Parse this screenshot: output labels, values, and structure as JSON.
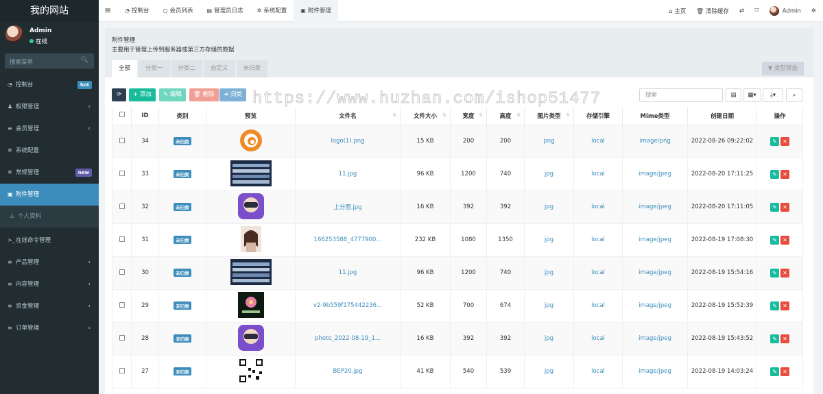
{
  "site_title": "我的网站",
  "user": {
    "name": "Admin",
    "status": "在线"
  },
  "search": {
    "placeholder": "搜索菜单"
  },
  "menu": [
    {
      "label": "控制台",
      "icon": "dashboard-icon",
      "badge": "hot",
      "badge_color": "#3c8dbc"
    },
    {
      "label": "权限管理",
      "icon": "users-icon",
      "arrow": true
    },
    {
      "label": "会员管理",
      "icon": "list-icon",
      "arrow": true
    },
    {
      "label": "系统配置",
      "icon": "cog-icon"
    },
    {
      "label": "常规管理",
      "icon": "cogs-icon",
      "badge": "new",
      "badge_color": "#605ca8"
    },
    {
      "label": "附件管理",
      "icon": "file-image-icon",
      "active": true
    },
    {
      "label": "个人资料",
      "icon": "user-icon",
      "sub": true
    },
    {
      "label": "在线命令管理",
      "icon": "terminal-icon"
    },
    {
      "label": "产品管理",
      "icon": "list-icon",
      "arrow": true
    },
    {
      "label": "内容管理",
      "icon": "list-icon",
      "arrow": true
    },
    {
      "label": "资金管理",
      "icon": "list-icon",
      "arrow": true
    },
    {
      "label": "订单管理",
      "icon": "list-icon",
      "arrow": true
    }
  ],
  "top_tabs": [
    {
      "label": "控制台",
      "icon": "dashboard-icon"
    },
    {
      "label": "会员列表",
      "icon": "circle-icon"
    },
    {
      "label": "管理员日志",
      "icon": "list-icon"
    },
    {
      "label": "系统配置",
      "icon": "cog-icon"
    },
    {
      "label": "附件管理",
      "icon": "file-image-icon",
      "active": true
    }
  ],
  "top_right": {
    "home": "主页",
    "clear_cache": "清除缓存",
    "admin": "Admin"
  },
  "panel": {
    "title": "附件管理",
    "description": "主要用于管理上传到服务器或第三方存储的数据",
    "category_tabs": [
      "全部",
      "分类一",
      "分类二",
      "自定义",
      "未归类"
    ],
    "filter_label": "类型筛选"
  },
  "toolbar": {
    "add": "添加",
    "edit": "编辑",
    "delete": "删除",
    "classify": "归类",
    "search_placeholder": "搜索"
  },
  "watermark": "https://www.huzhan.com/ishop51477",
  "table": {
    "headers": [
      "ID",
      "类别",
      "预览",
      "文件名",
      "文件大小",
      "宽度",
      "高度",
      "图片类型",
      "存储引擎",
      "Mime类型",
      "创建日期",
      "操作"
    ],
    "rows": [
      {
        "id": "34",
        "category": "未归类",
        "preview": "logo",
        "filename": "logo(1).png",
        "size": "15 KB",
        "width": "200",
        "height": "200",
        "type": "png",
        "storage": "local",
        "mime": "image/png",
        "date": "2022-08-26 09:22:02"
      },
      {
        "id": "33",
        "category": "未归类",
        "preview": "servers",
        "filename": "11.jpg",
        "size": "96 KB",
        "width": "1200",
        "height": "740",
        "type": "jpg",
        "storage": "local",
        "mime": "image/jpeg",
        "date": "2022-08-20 17:11:25"
      },
      {
        "id": "32",
        "category": "未归类",
        "preview": "vr",
        "filename": "上分图.jpg",
        "size": "16 KB",
        "width": "392",
        "height": "392",
        "type": "jpg",
        "storage": "local",
        "mime": "image/jpeg",
        "date": "2022-08-20 17:11:05"
      },
      {
        "id": "31",
        "category": "未归类",
        "preview": "person",
        "filename": "166253588_4777900...",
        "size": "232 KB",
        "width": "1080",
        "height": "1350",
        "type": "jpg",
        "storage": "local",
        "mime": "image/jpeg",
        "date": "2022-08-19 17:08:30"
      },
      {
        "id": "30",
        "category": "未归类",
        "preview": "servers",
        "filename": "11.jpg",
        "size": "96 KB",
        "width": "1200",
        "height": "740",
        "type": "jpg",
        "storage": "local",
        "mime": "image/jpeg",
        "date": "2022-08-19 15:54:16"
      },
      {
        "id": "29",
        "category": "未归类",
        "preview": "flower",
        "filename": "v2-9b559f175442236...",
        "size": "52 KB",
        "width": "700",
        "height": "674",
        "type": "jpg",
        "storage": "local",
        "mime": "image/jpeg",
        "date": "2022-08-19 15:52:39"
      },
      {
        "id": "28",
        "category": "未归类",
        "preview": "vr",
        "filename": "photo_2022-08-19_1...",
        "size": "16 KB",
        "width": "392",
        "height": "392",
        "type": "jpg",
        "storage": "local",
        "mime": "image/jpeg",
        "date": "2022-08-19 15:43:52"
      },
      {
        "id": "27",
        "category": "未归类",
        "preview": "qr",
        "filename": "BEP20.jpg",
        "size": "41 KB",
        "width": "540",
        "height": "539",
        "type": "jpg",
        "storage": "local",
        "mime": "image/jpeg",
        "date": "2022-08-19 14:03:24"
      }
    ]
  }
}
